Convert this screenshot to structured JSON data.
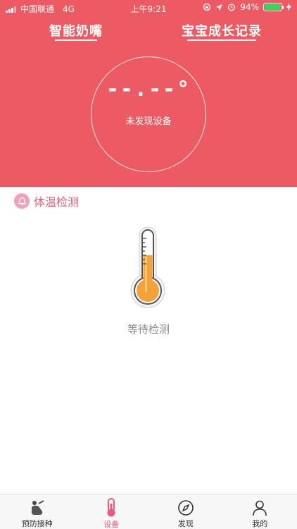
{
  "status_bar": {
    "carrier": "中国联通",
    "network": "4G",
    "time": "上午9:21",
    "battery": "94%",
    "battery_level": 0.94
  },
  "top_tabs": [
    {
      "label": "智能奶嘴"
    },
    {
      "label": "宝宝成长记录"
    }
  ],
  "reading": {
    "temperature": "--.--°",
    "device_status": "未发现设备"
  },
  "section": {
    "title": "体温检测",
    "icon": "bell-icon"
  },
  "thermometer": {
    "status": "等待检测",
    "icon": "thermometer-icon"
  },
  "bottom_nav": [
    {
      "label": "预防接种",
      "icon": "vaccine-icon",
      "active": false
    },
    {
      "label": "设备",
      "icon": "device-thermometer-icon",
      "active": true
    },
    {
      "label": "发现",
      "icon": "compass-icon",
      "active": false
    },
    {
      "label": "我的",
      "icon": "person-icon",
      "active": false
    }
  ],
  "colors": {
    "primary": "#ec5b64",
    "accent": "#e75b7d",
    "thermo_fill": "#f5a23a"
  }
}
